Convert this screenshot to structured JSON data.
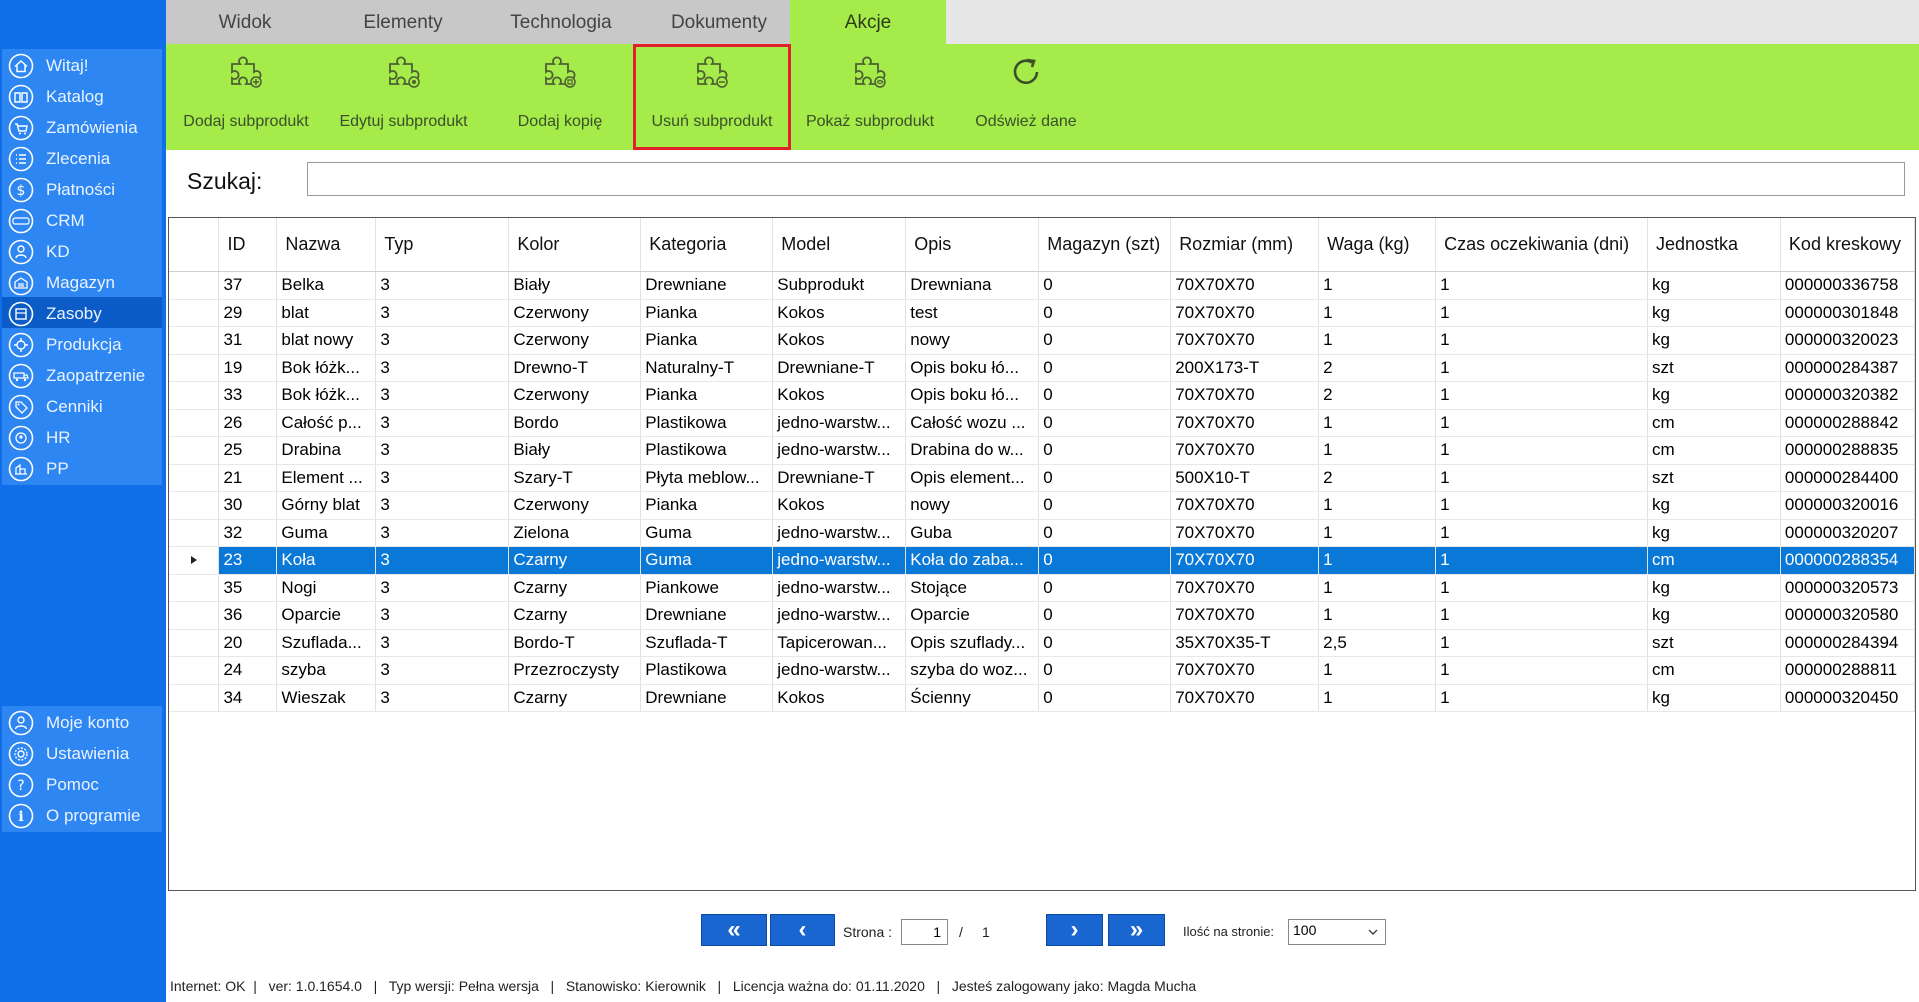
{
  "sidebar": {
    "items": [
      {
        "label": "Witaj!",
        "icon": "home-icon"
      },
      {
        "label": "Katalog",
        "icon": "book-icon"
      },
      {
        "label": "Zamówienia",
        "icon": "cart-icon"
      },
      {
        "label": "Zlecenia",
        "icon": "list-icon"
      },
      {
        "label": "Płatności",
        "icon": "dollar-icon"
      },
      {
        "label": "CRM",
        "icon": "crm-icon"
      },
      {
        "label": "KD",
        "icon": "user-icon"
      },
      {
        "label": "Magazyn",
        "icon": "warehouse-icon"
      },
      {
        "label": "Zasoby",
        "icon": "resources-icon"
      },
      {
        "label": "Produkcja",
        "icon": "production-icon"
      },
      {
        "label": "Zaopatrzenie",
        "icon": "supply-icon"
      },
      {
        "label": "Cenniki",
        "icon": "tag-icon"
      },
      {
        "label": "HR",
        "icon": "hr-icon"
      },
      {
        "label": "PP",
        "icon": "pp-icon"
      }
    ],
    "active": "Zasoby",
    "bottom_items": [
      {
        "label": "Moje konto",
        "icon": "account-icon"
      },
      {
        "label": "Ustawienia",
        "icon": "gear-icon"
      },
      {
        "label": "Pomoc",
        "icon": "help-icon"
      },
      {
        "label": "O programie",
        "icon": "info-icon"
      }
    ]
  },
  "tabs": [
    {
      "label": "Widok"
    },
    {
      "label": "Elementy"
    },
    {
      "label": "Technologia"
    },
    {
      "label": "Dokumenty"
    },
    {
      "label": "Akcje"
    }
  ],
  "active_tab": "Akcje",
  "ribbon": {
    "buttons": [
      {
        "label": "Dodaj subprodukt",
        "icon": "puzzle-add-icon"
      },
      {
        "label": "Edytuj subprodukt",
        "icon": "puzzle-edit-icon"
      },
      {
        "label": "Dodaj kopię",
        "icon": "puzzle-copy-icon"
      },
      {
        "label": "Usuń subprodukt",
        "icon": "puzzle-delete-icon"
      },
      {
        "label": "Pokaż subprodukt",
        "icon": "puzzle-show-icon"
      },
      {
        "label": "Odśwież dane",
        "icon": "refresh-icon"
      }
    ],
    "highlighted": "Usuń subprodukt"
  },
  "search": {
    "label": "Szukaj:",
    "value": ""
  },
  "table": {
    "columns": [
      "ID",
      "Nazwa",
      "Typ",
      "Kolor",
      "Kategoria",
      "Model",
      "Opis",
      "Magazyn (szt)",
      "Rozmiar (mm)",
      "Waga (kg)",
      "Czas oczekiwania (dni)",
      "Jednostka",
      "Kod kreskowy"
    ],
    "rows": [
      [
        "37",
        "Belka",
        "3",
        "Biały",
        "Drewniane",
        "Subprodukt",
        "Drewniana",
        "0",
        "70X70X70",
        "1",
        "1",
        "kg",
        "000000336758"
      ],
      [
        "29",
        "blat",
        "3",
        "Czerwony",
        "Pianka",
        "Kokos",
        "test",
        "0",
        "70X70X70",
        "1",
        "1",
        "kg",
        "000000301848"
      ],
      [
        "31",
        "blat nowy",
        "3",
        "Czerwony",
        "Pianka",
        "Kokos",
        "nowy",
        "0",
        "70X70X70",
        "1",
        "1",
        "kg",
        "000000320023"
      ],
      [
        "19",
        "Bok łóżk...",
        "3",
        "Drewno-T",
        "Naturalny-T",
        "Drewniane-T",
        "Opis boku łó...",
        "0",
        "200X173-T",
        "2",
        "1",
        "szt",
        "000000284387"
      ],
      [
        "33",
        "Bok łóżk...",
        "3",
        "Czerwony",
        "Pianka",
        "Kokos",
        "Opis boku łó...",
        "0",
        "70X70X70",
        "2",
        "1",
        "kg",
        "000000320382"
      ],
      [
        "26",
        "Całość p...",
        "3",
        "Bordo",
        "Plastikowa",
        "jedno-warstw...",
        "Całość wozu ...",
        "0",
        "70X70X70",
        "1",
        "1",
        "cm",
        "000000288842"
      ],
      [
        "25",
        "Drabina",
        "3",
        "Biały",
        "Plastikowa",
        "jedno-warstw...",
        "Drabina do w...",
        "0",
        "70X70X70",
        "1",
        "1",
        "cm",
        "000000288835"
      ],
      [
        "21",
        "Element ...",
        "3",
        "Szary-T",
        "Płyta meblow...",
        "Drewniane-T",
        "Opis element...",
        "0",
        "500X10-T",
        "2",
        "1",
        "szt",
        "000000284400"
      ],
      [
        "30",
        "Górny blat",
        "3",
        "Czerwony",
        "Pianka",
        "Kokos",
        "nowy",
        "0",
        "70X70X70",
        "1",
        "1",
        "kg",
        "000000320016"
      ],
      [
        "32",
        "Guma",
        "3",
        "Zielona",
        "Guma",
        "jedno-warstw...",
        "Guba",
        "0",
        "70X70X70",
        "1",
        "1",
        "kg",
        "000000320207"
      ],
      [
        "23",
        "Koła",
        "3",
        "Czarny",
        "Guma",
        "jedno-warstw...",
        "Koła do zaba...",
        "0",
        "70X70X70",
        "1",
        "1",
        "cm",
        "000000288354"
      ],
      [
        "35",
        "Nogi",
        "3",
        "Czarny",
        "Piankowe",
        "jedno-warstw...",
        "Stojące",
        "0",
        "70X70X70",
        "1",
        "1",
        "kg",
        "000000320573"
      ],
      [
        "36",
        "Oparcie",
        "3",
        "Czarny",
        "Drewniane",
        "jedno-warstw...",
        "Oparcie",
        "0",
        "70X70X70",
        "1",
        "1",
        "kg",
        "000000320580"
      ],
      [
        "20",
        "Szuflada...",
        "3",
        "Bordo-T",
        "Szuflada-T",
        "Tapicerowan...",
        "Opis szuflady...",
        "0",
        "35X70X35-T",
        "2,5",
        "1",
        "szt",
        "000000284394"
      ],
      [
        "24",
        "szyba",
        "3",
        "Przezroczysty",
        "Plastikowa",
        "jedno-warstw...",
        "szyba do woz...",
        "0",
        "70X70X70",
        "1",
        "1",
        "cm",
        "000000288811"
      ],
      [
        "34",
        "Wieszak",
        "3",
        "Czarny",
        "Drewniane",
        "Kokos",
        "Ścienny",
        "0",
        "70X70X70",
        "1",
        "1",
        "kg",
        "000000320450"
      ]
    ],
    "selected_row_index": 10
  },
  "pager": {
    "first": "«",
    "prev": "‹",
    "next": "›",
    "last": "»",
    "page_label": "Strona :",
    "page_value": "1",
    "separator": "/",
    "total_pages": "1",
    "per_page_label": "Ilość na stronie:",
    "per_page_value": "100"
  },
  "status": {
    "text": "Internet: OK  |   ver: 1.0.1654.0   |   Typ wersji: Pełna wersja   |   Stanowisko: Kierownik   |   Licencja ważna do: 01.11.2020   |   Jesteś zalogowany jako: Magda Mucha"
  },
  "colors": {
    "sidebar_bg": "#0f6ee8",
    "nav_item": "#2d86f2",
    "ribbon": "#a5eb4a",
    "selection": "#0a78d7",
    "highlight": "#e2202a",
    "pager_button": "#1a66d1"
  }
}
